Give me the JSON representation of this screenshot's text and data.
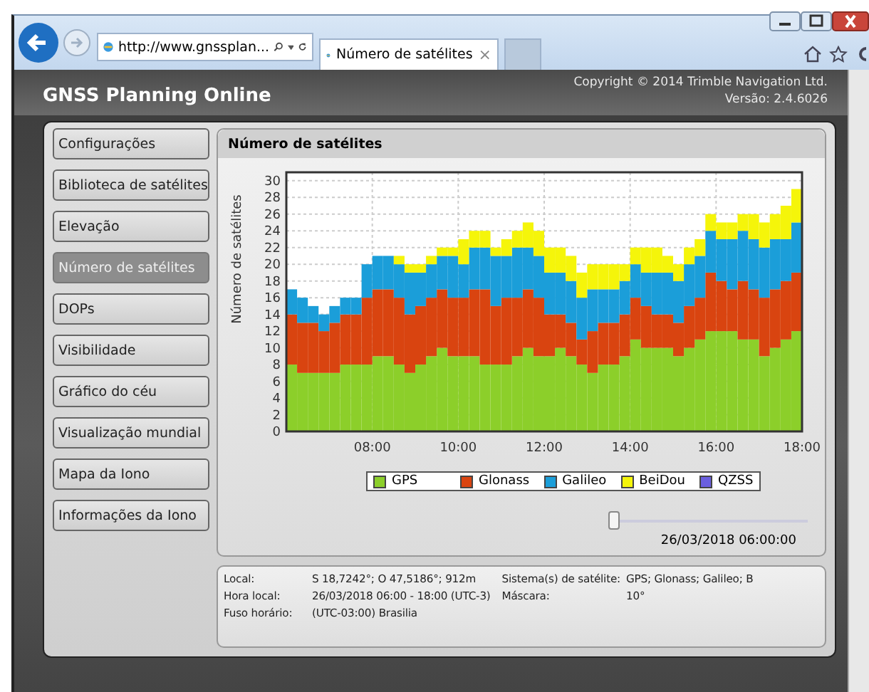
{
  "browser": {
    "address": "http://www.gnssplan...",
    "tab": {
      "title": "Número de satélites",
      "close": "×"
    }
  },
  "app": {
    "title": "GNSS Planning Online",
    "copyright": "Copyright © 2014 Trimble Navigation Ltd.",
    "version": "Versão: 2.4.6026"
  },
  "nav": {
    "items": [
      {
        "label": "Configurações",
        "selected": false
      },
      {
        "label": "Biblioteca de satélites",
        "selected": false
      },
      {
        "label": "Elevação",
        "selected": false
      },
      {
        "label": "Número de satélites",
        "selected": true
      },
      {
        "label": "DOPs",
        "selected": false
      },
      {
        "label": "Visibilidade",
        "selected": false
      },
      {
        "label": "Gráfico do céu",
        "selected": false
      },
      {
        "label": "Visualização mundial",
        "selected": false
      },
      {
        "label": "Mapa da Iono",
        "selected": false
      },
      {
        "label": "Informações da Iono",
        "selected": false
      }
    ]
  },
  "panel": {
    "title": "Número de satélites",
    "chart_data": {
      "type": "bar",
      "stacked": true,
      "ylabel": "Número de satélites",
      "xlim": [
        6,
        18
      ],
      "ylim": [
        0,
        31
      ],
      "grid": true,
      "x": [
        6.125,
        6.375,
        6.625,
        6.875,
        7.125,
        7.375,
        7.625,
        7.875,
        8.125,
        8.375,
        8.625,
        8.875,
        9.125,
        9.375,
        9.625,
        9.875,
        10.125,
        10.375,
        10.625,
        10.875,
        11.125,
        11.375,
        11.625,
        11.875,
        12.125,
        12.375,
        12.625,
        12.875,
        13.125,
        13.375,
        13.625,
        13.875,
        14.125,
        14.375,
        14.625,
        14.875,
        15.125,
        15.375,
        15.625,
        15.875,
        16.125,
        16.375,
        16.625,
        16.875,
        17.125,
        17.375,
        17.625,
        17.875
      ],
      "xticks": [
        {
          "value": 8,
          "label": "08:00"
        },
        {
          "value": 10,
          "label": "10:00"
        },
        {
          "value": 12,
          "label": "12:00"
        },
        {
          "value": 14,
          "label": "14:00"
        },
        {
          "value": 16,
          "label": "16:00"
        },
        {
          "value": 18,
          "label": "18:00"
        }
      ],
      "yticks": [
        0,
        2,
        4,
        6,
        8,
        10,
        12,
        14,
        16,
        18,
        20,
        22,
        24,
        26,
        28,
        30
      ],
      "series": [
        {
          "name": "GPS",
          "color": "#8ccf2a",
          "values": [
            8,
            7,
            7,
            7,
            7,
            8,
            8,
            8,
            9,
            9,
            8,
            7,
            8,
            9,
            10,
            9,
            9,
            9,
            8,
            8,
            8,
            9,
            10,
            9,
            9,
            10,
            9,
            8,
            7,
            8,
            8,
            9,
            11,
            10,
            10,
            10,
            9,
            10,
            11,
            12,
            12,
            12,
            11,
            11,
            9,
            10,
            11,
            12
          ]
        },
        {
          "name": "Glonass",
          "color": "#d94410",
          "values": [
            6,
            6,
            6,
            5,
            6,
            6,
            6,
            8,
            8,
            8,
            8,
            7,
            7,
            7,
            7,
            7,
            7,
            8,
            9,
            7,
            8,
            7,
            7,
            7,
            5,
            4,
            4,
            3,
            5,
            5,
            5,
            5,
            5,
            5,
            4,
            4,
            4,
            5,
            5,
            7,
            6,
            5,
            7,
            6,
            7,
            7,
            7,
            7
          ]
        },
        {
          "name": "Galileo",
          "color": "#1b9ed9",
          "values": [
            3,
            3,
            2,
            2,
            2,
            2,
            2,
            4,
            4,
            4,
            4,
            5,
            4,
            4,
            4,
            5,
            4,
            5,
            5,
            6,
            5,
            6,
            5,
            5,
            5,
            5,
            5,
            5,
            5,
            4,
            4,
            4,
            4,
            4,
            5,
            5,
            5,
            5,
            5,
            5,
            5,
            6,
            6,
            6,
            6,
            6,
            5,
            6
          ]
        },
        {
          "name": "BeiDou",
          "color": "#f5f50a",
          "values": [
            0,
            0,
            0,
            0,
            0,
            0,
            0,
            0,
            0,
            0,
            1,
            1,
            1,
            1,
            1,
            1,
            3,
            2,
            2,
            1,
            2,
            2,
            3,
            3,
            3,
            3,
            3,
            3,
            3,
            3,
            3,
            2,
            2,
            3,
            3,
            2,
            2,
            2,
            2,
            2,
            2,
            2,
            2,
            3,
            3,
            3,
            4,
            4
          ]
        },
        {
          "name": "QZSS",
          "color": "#6a5fe0",
          "values": [
            0,
            0,
            0,
            0,
            0,
            0,
            0,
            0,
            0,
            0,
            0,
            0,
            0,
            0,
            0,
            0,
            0,
            0,
            0,
            0,
            0,
            0,
            0,
            0,
            0,
            0,
            0,
            0,
            0,
            0,
            0,
            0,
            0,
            0,
            0,
            0,
            0,
            0,
            0,
            0,
            0,
            0,
            0,
            0,
            0,
            0,
            0,
            0
          ]
        }
      ]
    },
    "slider": {
      "level": 0,
      "reading": "26/03/2018 06:00:00"
    }
  },
  "info": {
    "left": [
      {
        "label": "Local:",
        "value": "S 18,7242°; O 47,5186°; 912m"
      },
      {
        "label": "Hora local:",
        "value": "26/03/2018 06:00 - 18:00 (UTC-3)"
      },
      {
        "label": "Fuso horário:",
        "value": "(UTC-03:00) Brasilia"
      }
    ],
    "right": [
      {
        "label": "Sistema(s) de satélite:",
        "value": "GPS; Glonass; Galileo; B"
      },
      {
        "label": "Máscara:",
        "value": "10°"
      }
    ]
  }
}
